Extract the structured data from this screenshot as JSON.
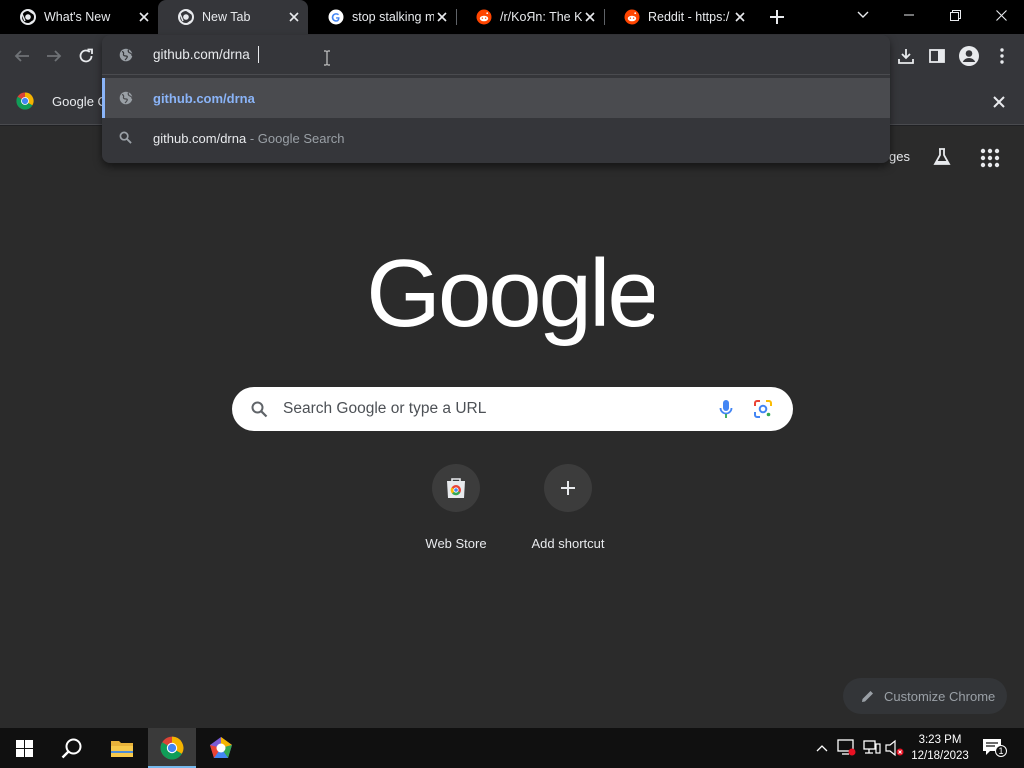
{
  "tabs": [
    {
      "title": "What's New",
      "icon": "chrome-icon",
      "active": false
    },
    {
      "title": "New Tab",
      "icon": "chrome-icon",
      "active": true
    },
    {
      "title": "stop stalking m",
      "icon": "google-g-icon",
      "active": false
    },
    {
      "title": "/r/KoЯn: The K",
      "icon": "reddit-icon",
      "active": false
    },
    {
      "title": "Reddit - https:/",
      "icon": "reddit-icon",
      "active": false
    }
  ],
  "omnibox": {
    "input_value": "github.com/drna",
    "suggestions": [
      {
        "text": "github.com/drna",
        "suffix": "",
        "icon": "globe-icon",
        "selected": true
      },
      {
        "text": "github.com/drna",
        "suffix": " - Google Search",
        "icon": "search-icon",
        "selected": false
      }
    ]
  },
  "bookmarkbar": {
    "item_label": "Google C",
    "right_fragment": "ges"
  },
  "ntp": {
    "logo_text": "Google",
    "search_placeholder": "Search Google or type a URL",
    "shortcuts": [
      {
        "label": "Web Store",
        "icon": "web-store-icon"
      },
      {
        "label": "Add shortcut",
        "icon": "plus-icon"
      }
    ],
    "customize_label": "Customize Chrome"
  },
  "taskbar": {
    "time": "3:23 PM",
    "date": "12/18/2023",
    "notification_count": "1"
  },
  "colors": {
    "tabstrip_bg": "#000000",
    "toolbar_bg": "#35363a",
    "ntp_bg": "#2b2b2b",
    "accent_link": "#8ab4f8",
    "selected_bar": "#8ab4f8"
  }
}
